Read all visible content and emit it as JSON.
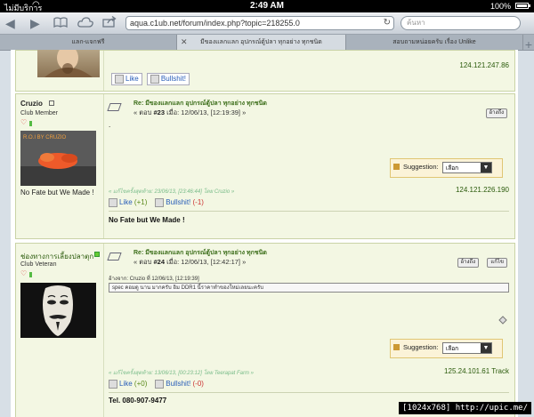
{
  "statusbar": {
    "carrier": "ไม่มีบริการ",
    "time": "2:49 AM",
    "battery": "100%"
  },
  "browser": {
    "url": "aqua.c1ub.net/forum/index.php?topic=218255.0",
    "search_placeholder": "ค้นหา",
    "tabs": [
      {
        "label": "แลก-แจกฟรี"
      },
      {
        "label": "มีของแลกแลก อุปกรณ์ตู้ปลา ทุกอย่าง ทุกชนิด"
      },
      {
        "label": "สอบถามหน่อยครับ เรื่อง Unlike"
      }
    ]
  },
  "post_top": {
    "like_label": "Like",
    "bullshit_label": "Bullshit!",
    "ip": "124.121.247.86"
  },
  "post23": {
    "author": "Cruzio",
    "rank": "Club Member",
    "avatar_caption": "R.O.I BY CRUZIO",
    "signature_left": "No Fate but We Made !",
    "title": "Re: มีของแลกแลก อุปกรณ์ตู้ปลา ทุกอย่าง ทุกชนิด",
    "reply_prefix": "« ตอบ",
    "reply_num": "#23",
    "reply_when": "เมื่อ: 12/06/13, [12:19:39] »",
    "quote_button": "อ้างถึง",
    "body": ".",
    "suggestion_label": "Suggestion:",
    "suggestion_value": "เลือก",
    "edited": "« แก้ไขครั้งสุดท้าย: 23/06/13, [23:46:44] โดย Cruzio »",
    "ip": "124.121.226.190",
    "like_label": "Like",
    "like_count": "(+1)",
    "bullshit_label": "Bullshit!",
    "bullshit_count": "(-1)",
    "signature": "No Fate but We Made !"
  },
  "post24": {
    "author": "ช่องทางการเลี้ยงปลาตุก",
    "rank": "Club Veteran",
    "title": "Re: มีของแลกแลก อุปกรณ์ตู้ปลา ทุกอย่าง ทุกชนิด",
    "reply_prefix": "« ตอบ",
    "reply_num": "#24",
    "reply_when": "เมื่อ: 12/06/13, [12:42:17] »",
    "quote_button": "อ้างถึง",
    "modify_button": "แก้ไข",
    "quote_from": "อ้างจาก: Cruzio ที่ 12/06/13, [12:19:39]",
    "quote_text": "spec คอมดู นาน มากครับ อิม DDR1 นี้ราคาทำของใหม่เลยนะครับ",
    "suggestion_label": "Suggestion:",
    "suggestion_value": "เลือก",
    "edited": "« แก้ไขครั้งสุดท้าย: 13/06/13, [00:23:12] โดย Teerapat Farm »",
    "ip": "125.24.101.61 Track",
    "like_label": "Like",
    "like_count": "(+0)",
    "bullshit_label": "Bullshit!",
    "bullshit_count": "(-0)",
    "tel": "Tel. 080-907-9477"
  },
  "watermark": "[1024x768] http://upic.me/"
}
